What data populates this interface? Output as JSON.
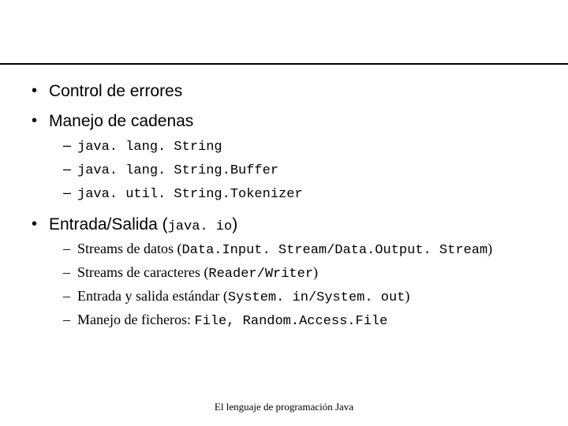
{
  "bullets": {
    "item1": "Control de errores",
    "item2": "Manejo de cadenas",
    "item2_sub1": "java. lang. String",
    "item2_sub2": "java. lang. String.Buffer",
    "item2_sub3": "java. util. String.Tokenizer",
    "item3_prefix": "Entrada/Salida (",
    "item3_code": "java. io",
    "item3_suffix": ")",
    "item3_sub1_prefix": "Streams de datos (",
    "item3_sub1_code": "Data.Input. Stream/Data.Output. Stream",
    "item3_sub1_suffix": ")",
    "item3_sub2_prefix": "Streams de caracteres (",
    "item3_sub2_code": "Reader/Writer",
    "item3_sub2_suffix": ")",
    "item3_sub3_prefix": "Entrada y salida estándar (",
    "item3_sub3_code": "System. in/System. out",
    "item3_sub3_suffix": ")",
    "item3_sub4_prefix": "Manejo de ficheros: ",
    "item3_sub4_code": "File, Random.Access.File"
  },
  "footer": "El lenguaje de programación Java"
}
